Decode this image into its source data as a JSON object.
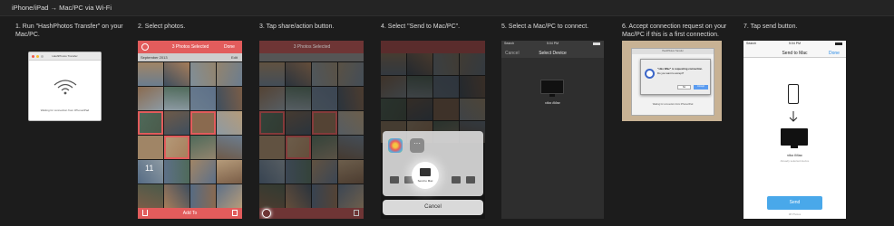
{
  "header": {
    "title": "iPhone/iPad → Mac/PC via Wi-Fi"
  },
  "steps": [
    {
      "caption": "1. Run \"HashPhotos Transfer\" on your Mac/PC."
    },
    {
      "caption": "2. Select photos."
    },
    {
      "caption": "3. Tap share/action button."
    },
    {
      "caption": "4. Select \"Send to Mac/PC\"."
    },
    {
      "caption": "5. Select a Mac/PC to connect."
    },
    {
      "caption": "6. Accept connection request on your Mac/PC if this is a first connection."
    },
    {
      "caption": "7. Tap send button."
    }
  ],
  "mac_window": {
    "title": "HashPhotos Transfer",
    "message": "Waiting for connection from iPhone/iPad"
  },
  "select_photos": {
    "nav_title": "3 Photos Selected",
    "nav_done": "Done",
    "section": "September 2013",
    "section_right": "Edit",
    "count_label": "11",
    "bottom_action": "Add To"
  },
  "share_screen": {
    "nav_title": "3 Photos Selected",
    "send_label": "Send to Mac",
    "cancel": "Cancel"
  },
  "select_device": {
    "status_left": "Search",
    "status_time": "5:04 PM",
    "nav_cancel": "Cancel",
    "nav_title": "Select Device",
    "device": "viko iMac"
  },
  "accept_dialog": {
    "window_title": "HashPhotos Transfer",
    "text1": "\"viko iMac\" is requesting connection.",
    "text2": "Do you want to accept?",
    "no": "No",
    "yes": "Accept",
    "waiting": "Waiting for connection from iPhone/iPad"
  },
  "send_screen": {
    "status_left": "Search",
    "status_time": "5:04 PM",
    "nav_title": "Send to Mac",
    "nav_done": "Done",
    "device": "viko iMac",
    "device_sub": "Already selected device",
    "send_button": "Send",
    "count_text": "38 Photos"
  }
}
